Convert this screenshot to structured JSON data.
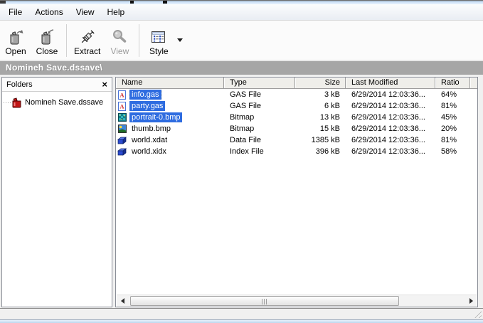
{
  "menu": {
    "items": [
      {
        "label": "File"
      },
      {
        "label": "Actions"
      },
      {
        "label": "View"
      },
      {
        "label": "Help"
      }
    ]
  },
  "toolbar": {
    "buttons": [
      {
        "label": "Open",
        "disabled": false
      },
      {
        "label": "Close",
        "disabled": false
      },
      {
        "label": "Extract",
        "disabled": false
      },
      {
        "label": "View",
        "disabled": true
      },
      {
        "label": "Style",
        "disabled": false,
        "has_dropdown": true
      }
    ]
  },
  "address_bar": {
    "path": "Nomineh Save.dssave\\"
  },
  "folders_panel": {
    "title": "Folders",
    "close_glyph": "×",
    "tree": [
      {
        "label": "Nomineh Save.dssave",
        "icon": "archive-icon"
      }
    ]
  },
  "file_list": {
    "columns": [
      {
        "label": "Name"
      },
      {
        "label": "Type"
      },
      {
        "label": "Size",
        "align": "right"
      },
      {
        "label": "Last Modified"
      },
      {
        "label": "Ratio"
      }
    ],
    "rows": [
      {
        "name": "info.gas",
        "type": "GAS File",
        "size": "3 kB",
        "modified": "6/29/2014 12:03:36...",
        "ratio": "64%",
        "icon": "gas-file-icon",
        "selected": true,
        "focused": true
      },
      {
        "name": "party.gas",
        "type": "GAS File",
        "size": "6 kB",
        "modified": "6/29/2014 12:03:36...",
        "ratio": "81%",
        "icon": "gas-file-icon",
        "selected": true,
        "focused": false
      },
      {
        "name": "portrait-0.bmp",
        "type": "Bitmap",
        "size": "13 kB",
        "modified": "6/29/2014 12:03:36...",
        "ratio": "45%",
        "icon": "bitmap-texture-icon",
        "selected": true,
        "focused": false
      },
      {
        "name": "thumb.bmp",
        "type": "Bitmap",
        "size": "15 kB",
        "modified": "6/29/2014 12:03:36...",
        "ratio": "20%",
        "icon": "bitmap-image-icon",
        "selected": false,
        "focused": false
      },
      {
        "name": "world.xdat",
        "type": "Data File",
        "size": "1385 kB",
        "modified": "6/29/2014 12:03:36...",
        "ratio": "81%",
        "icon": "data-cube-icon",
        "selected": false,
        "focused": false
      },
      {
        "name": "world.xidx",
        "type": "Index File",
        "size": "396 kB",
        "modified": "6/29/2014 12:03:36...",
        "ratio": "58%",
        "icon": "data-cube-icon",
        "selected": false,
        "focused": false
      }
    ]
  },
  "status_bar": {
    "text": ""
  },
  "colors": {
    "selection": "#2e6ce0",
    "address_bar": "#a6a6a6",
    "titlebar_strip": "#cfe3f7",
    "bottom_edge": "#bcd6ee"
  }
}
